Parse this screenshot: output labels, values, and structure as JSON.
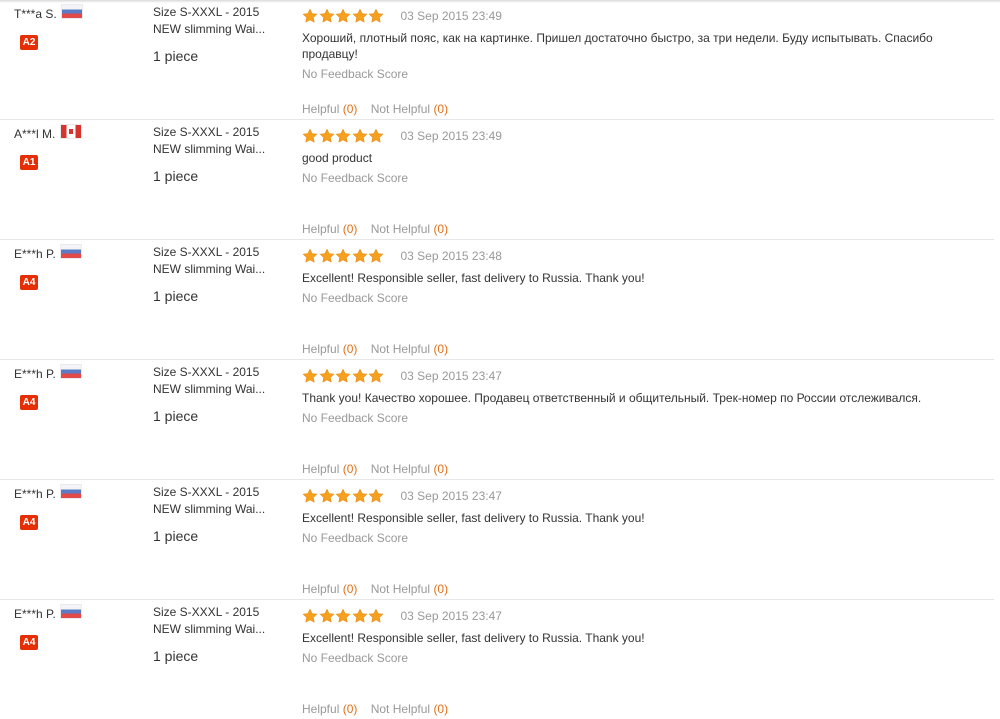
{
  "reviews": [
    {
      "buyer_name": "T***a S.",
      "country_flag": "flag-russia",
      "buyer_level": "A2",
      "product_size": "Size S-XXXL - 2015",
      "product_title": "NEW slimming Wai...",
      "quantity": "1 piece",
      "rating": 5,
      "date": "03 Sep 2015 23:49",
      "text": "Хороший, плотный пояс, как на картинке. Пришел достаточно быстро, за три недели. Буду испытывать. Спасибо продавцу!",
      "feedback_score": "No Feedback Score",
      "helpful_label": "Helpful",
      "helpful_count": "(0)",
      "not_helpful_label": "Not Helpful",
      "not_helpful_count": "(0)"
    },
    {
      "buyer_name": "A***l M.",
      "country_flag": "flag-canada",
      "buyer_level": "A1",
      "product_size": "Size S-XXXL - 2015",
      "product_title": "NEW slimming Wai...",
      "quantity": "1 piece",
      "rating": 5,
      "date": "03 Sep 2015 23:49",
      "text": "good product",
      "feedback_score": "No Feedback Score",
      "helpful_label": "Helpful",
      "helpful_count": "(0)",
      "not_helpful_label": "Not Helpful",
      "not_helpful_count": "(0)"
    },
    {
      "buyer_name": "E***h P.",
      "country_flag": "flag-russia",
      "buyer_level": "A4",
      "product_size": "Size S-XXXL - 2015",
      "product_title": "NEW slimming Wai...",
      "quantity": "1 piece",
      "rating": 5,
      "date": "03 Sep 2015 23:48",
      "text": "Excellent! Responsible seller, fast delivery to Russia. Thank you!",
      "feedback_score": "No Feedback Score",
      "helpful_label": "Helpful",
      "helpful_count": "(0)",
      "not_helpful_label": "Not Helpful",
      "not_helpful_count": "(0)"
    },
    {
      "buyer_name": "E***h P.",
      "country_flag": "flag-russia",
      "buyer_level": "A4",
      "product_size": "Size S-XXXL - 2015",
      "product_title": "NEW slimming Wai...",
      "quantity": "1 piece",
      "rating": 5,
      "date": "03 Sep 2015 23:47",
      "text": "Thank you! Качество хорошее. Продавец ответственный и общительный. Трек-номер по России отслеживался.",
      "feedback_score": "No Feedback Score",
      "helpful_label": "Helpful",
      "helpful_count": "(0)",
      "not_helpful_label": "Not Helpful",
      "not_helpful_count": "(0)"
    },
    {
      "buyer_name": "E***h P.",
      "country_flag": "flag-russia",
      "buyer_level": "A4",
      "product_size": "Size S-XXXL - 2015",
      "product_title": "NEW slimming Wai...",
      "quantity": "1 piece",
      "rating": 5,
      "date": "03 Sep 2015 23:47",
      "text": "Excellent! Responsible seller, fast delivery to Russia. Thank you!",
      "feedback_score": "No Feedback Score",
      "helpful_label": "Helpful",
      "helpful_count": "(0)",
      "not_helpful_label": "Not Helpful",
      "not_helpful_count": "(0)"
    },
    {
      "buyer_name": "E***h P.",
      "country_flag": "flag-russia",
      "buyer_level": "A4",
      "product_size": "Size S-XXXL - 2015",
      "product_title": "NEW slimming Wai...",
      "quantity": "1 piece",
      "rating": 5,
      "date": "03 Sep 2015 23:47",
      "text": "Excellent! Responsible seller, fast delivery to Russia. Thank you!",
      "feedback_score": "No Feedback Score",
      "helpful_label": "Helpful",
      "helpful_count": "(0)",
      "not_helpful_label": "Not Helpful",
      "not_helpful_count": "(0)"
    }
  ],
  "colors": {
    "level_badge": "#e62e04",
    "star": "#f7a01e",
    "vote_count": "#e0701a",
    "muted_text": "#999999"
  }
}
